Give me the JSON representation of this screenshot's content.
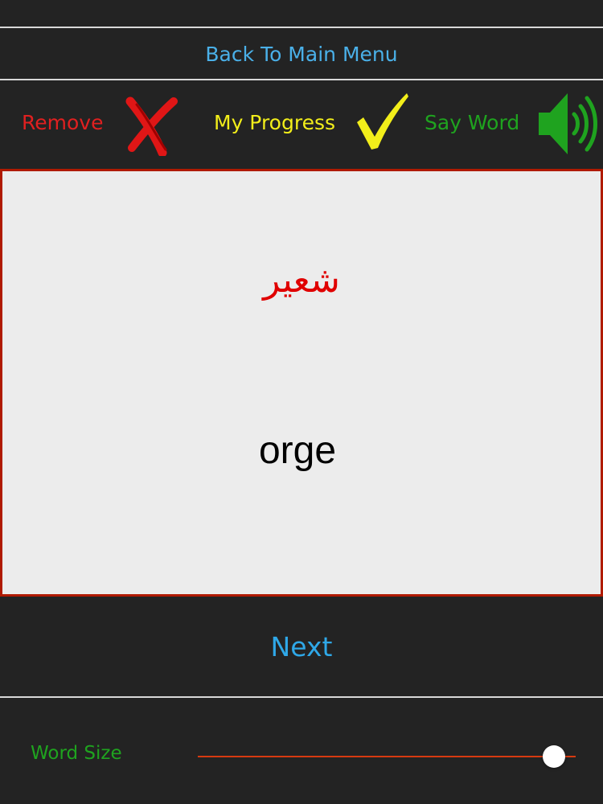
{
  "header": {
    "back_label": "Back To Main Menu"
  },
  "toolbar": {
    "remove_label": "Remove",
    "progress_label": "My Progress",
    "say_word_label": "Say Word",
    "remove_icon": "red-x-icon",
    "progress_icon": "yellow-checkmark-icon",
    "say_word_icon": "speaker-icon"
  },
  "card": {
    "arabic_word": "شعير",
    "translation": "orge"
  },
  "footer": {
    "next_label": "Next",
    "word_size_label": "Word Size",
    "word_size_value": 0.97
  },
  "colors": {
    "background": "#232323",
    "link_blue": "#4ab0e8",
    "remove_red": "#e02020",
    "progress_yellow": "#f2ee1a",
    "say_word_green": "#1fa31f",
    "card_border": "#b01a00",
    "card_background": "#ececec",
    "slider_track": "#d73a10"
  }
}
